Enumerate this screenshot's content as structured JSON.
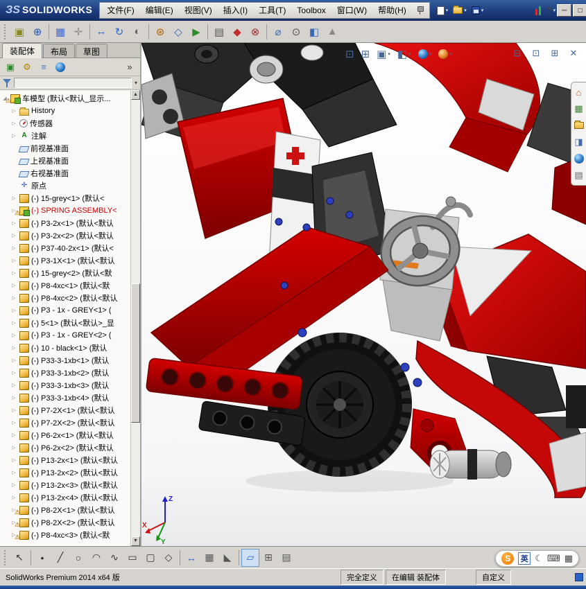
{
  "window": {
    "logo_mark": "ЗS",
    "logo_text": "SOLIDWORKS",
    "buttons": [
      {
        "name": "minimize-button",
        "glyph": "─"
      },
      {
        "name": "maximize-button",
        "glyph": "□"
      },
      {
        "name": "close-button",
        "glyph": "✕"
      }
    ]
  },
  "menubar": [
    "文件(F)",
    "编辑(E)",
    "视图(V)",
    "插入(I)",
    "工具(T)",
    "Toolbox",
    "窗口(W)",
    "帮助(H)"
  ],
  "quickbar": [
    {
      "name": "new-document-button",
      "type": "page",
      "caret": true
    },
    {
      "name": "open-button",
      "type": "folder",
      "caret": true
    },
    {
      "name": "save-button",
      "type": "floppy",
      "caret": true
    },
    {
      "gap": true
    },
    {
      "name": "rebuild-indicator-icon",
      "type": "bars"
    },
    {
      "name": "help-button",
      "type": "glyph",
      "glyph": "?",
      "caret": true
    }
  ],
  "toolbar": [
    {
      "name": "insert-component-icon",
      "glyph": "▣",
      "color": "#8a8a20"
    },
    {
      "name": "mate-icon",
      "glyph": "⊕",
      "color": "#2255bb"
    },
    {
      "sep": true
    },
    {
      "name": "linear-pattern-icon",
      "glyph": "▦",
      "color": "#4466cc"
    },
    {
      "name": "smart-fasteners-icon",
      "glyph": "✛",
      "color": "#888888"
    },
    {
      "sep": true
    },
    {
      "name": "move-component-icon",
      "glyph": "↔",
      "color": "#2a6ad0"
    },
    {
      "name": "rotate-component-icon",
      "glyph": "↻",
      "color": "#2a6ad0"
    },
    {
      "name": "show-hidden-components-icon",
      "glyph": "◐",
      "color": "#666666"
    },
    {
      "sep": true
    },
    {
      "name": "assembly-features-icon",
      "glyph": "⊛",
      "color": "#b06000"
    },
    {
      "name": "reference-geometry-icon",
      "glyph": "◇",
      "color": "#3a6ab5"
    },
    {
      "name": "motion-study-icon",
      "glyph": "▶",
      "color": "#2e8b2e"
    },
    {
      "sep": true
    },
    {
      "name": "bom-icon",
      "glyph": "▤",
      "color": "#555555"
    },
    {
      "name": "exploded-view-icon",
      "glyph": "◆",
      "color": "#c03030"
    },
    {
      "name": "interference-check-icon",
      "glyph": "⊗",
      "color": "#a03030"
    },
    {
      "sep": true
    },
    {
      "name": "measure-icon",
      "glyph": "⌀",
      "color": "#3a6ab5"
    },
    {
      "name": "mass-properties-icon",
      "glyph": "⊙",
      "color": "#555555"
    },
    {
      "name": "section-view-icon",
      "glyph": "◧",
      "color": "#3a6ab5"
    },
    {
      "name": "instant3d-icon",
      "glyph": "▲",
      "color": "#888888"
    }
  ],
  "tabs": [
    {
      "label": "装配体",
      "active": true
    },
    {
      "label": "布局",
      "active": false
    },
    {
      "label": "草图",
      "active": false
    }
  ],
  "panel_toolbar": [
    {
      "name": "featuremanager-tree-tab-icon",
      "glyph": "▣",
      "color": "#2e8b2e"
    },
    {
      "name": "propertymanager-tab-icon",
      "glyph": "⚙",
      "color": "#b8860b"
    },
    {
      "name": "configurationmanager-tab-icon",
      "glyph": "≡",
      "color": "#5577bb"
    },
    {
      "name": "displaymanager-tab-icon",
      "type": "ball1"
    },
    {
      "name": "panel-expand-chevron",
      "glyph": "»",
      "color": "#333333",
      "right": true
    }
  ],
  "tree": [
    {
      "label": "车模型 (默认<默认_显示...",
      "icon": "assembly",
      "expander": "collapse",
      "warn": true,
      "level": 0
    },
    {
      "label": "History",
      "icon": "folder",
      "expander": "expand",
      "level": 1
    },
    {
      "label": "传感器",
      "icon": "sensors",
      "expander": "expand",
      "level": 1
    },
    {
      "label": "注解",
      "icon": "annotations",
      "expander": "expand",
      "level": 1
    },
    {
      "label": "前视基准面",
      "icon": "plane",
      "level": 1
    },
    {
      "label": "上视基准面",
      "icon": "plane",
      "level": 1
    },
    {
      "label": "右视基准面",
      "icon": "plane",
      "level": 1
    },
    {
      "label": "原点",
      "icon": "origin",
      "level": 1
    },
    {
      "label": "(-) 15-grey<1> (默认<",
      "icon": "part",
      "expander": "expand",
      "level": 1
    },
    {
      "label": "(-) SPRING ASSEMBLY<",
      "icon": "assembly",
      "expander": "expand",
      "warn": true,
      "red": true,
      "level": 1
    },
    {
      "label": "(-) P3-2x<1> (默认<默认",
      "icon": "part",
      "expander": "expand",
      "level": 1
    },
    {
      "label": "(-) P3-2x<2> (默认<默认",
      "icon": "part",
      "expander": "expand",
      "level": 1
    },
    {
      "label": "(-) P37-40-2x<1> (默认<",
      "icon": "part",
      "expander": "expand",
      "level": 1
    },
    {
      "label": "(-) P3-1X<1> (默认<默认",
      "icon": "part",
      "expander": "expand",
      "level": 1
    },
    {
      "label": "(-) 15-grey<2> (默认<默",
      "icon": "part",
      "expander": "expand",
      "level": 1
    },
    {
      "label": "(-) P8-4xc<1> (默认<默",
      "icon": "part",
      "expander": "expand",
      "level": 1
    },
    {
      "label": "(-) P8-4xc<2> (默认<默认",
      "icon": "part",
      "expander": "expand",
      "level": 1
    },
    {
      "label": "(-) P3 - 1x - GREY<1> (",
      "icon": "part",
      "expander": "expand",
      "level": 1
    },
    {
      "label": "(-) 5<1> (默认<默认>_显",
      "icon": "part",
      "expander": "expand",
      "level": 1
    },
    {
      "label": "(-) P3 - 1x - GREY<2> (",
      "icon": "part",
      "expander": "expand",
      "level": 1
    },
    {
      "label": "(-) 10 - black<1> (默认",
      "icon": "part",
      "expander": "expand",
      "level": 1
    },
    {
      "label": "(-) P33-3-1xb<1> (默认",
      "icon": "part",
      "expander": "expand",
      "level": 1
    },
    {
      "label": "(-) P33-3-1xb<2> (默认",
      "icon": "part",
      "expander": "expand",
      "level": 1
    },
    {
      "label": "(-) P33-3-1xb<3> (默认",
      "icon": "part",
      "expander": "expand",
      "level": 1
    },
    {
      "label": "(-) P33-3-1xb<4> (默认",
      "icon": "part",
      "expander": "expand",
      "level": 1
    },
    {
      "label": "(-) P7-2X<1> (默认<默认",
      "icon": "part",
      "expander": "expand",
      "level": 1
    },
    {
      "label": "(-) P7-2X<2> (默认<默认",
      "icon": "part",
      "expander": "expand",
      "level": 1
    },
    {
      "label": "(-) P6-2x<1> (默认<默认",
      "icon": "part",
      "expander": "expand",
      "level": 1
    },
    {
      "label": "(-) P6-2x<2> (默认<默认",
      "icon": "part",
      "expander": "expand",
      "level": 1
    },
    {
      "label": "(-) P13-2x<1> (默认<默认",
      "icon": "part",
      "expander": "expand",
      "level": 1
    },
    {
      "label": "(-) P13-2x<2> (默认<默认",
      "icon": "part",
      "expander": "expand",
      "level": 1
    },
    {
      "label": "(-) P13-2x<3> (默认<默认",
      "icon": "part",
      "expander": "expand",
      "level": 1
    },
    {
      "label": "(-) P13-2x<4> (默认<默认",
      "icon": "part",
      "expander": "expand",
      "level": 1
    },
    {
      "label": "(-) P8-2X<1> (默认<默认",
      "icon": "part",
      "expander": "expand",
      "warn": true,
      "level": 1
    },
    {
      "label": "(-) P8-2X<2> (默认<默认",
      "icon": "part",
      "expander": "expand",
      "warn": true,
      "level": 1
    },
    {
      "label": "(-) P8-4xc<3> (默认<默",
      "icon": "part",
      "expander": "expand",
      "warn": true,
      "level": 1
    }
  ],
  "hud": [
    {
      "name": "zoom-fit-icon",
      "glyph": "⊡",
      "color": "#456a9a"
    },
    {
      "name": "zoom-area-icon",
      "glyph": "⊞",
      "color": "#456a9a"
    },
    {
      "name": "view-orientation-icon",
      "glyph": "▣",
      "color": "#456a9a",
      "caret": true
    },
    {
      "name": "display-style-icon",
      "glyph": "◧",
      "color": "#456a9a",
      "caret": true
    },
    {
      "name": "appearances-icon",
      "type": "ball1",
      "caret": true
    },
    {
      "name": "scene-icon",
      "type": "ball2",
      "caret": true
    }
  ],
  "doc_buttons": [
    {
      "name": "doc-minimize-button",
      "glyph": "⊟",
      "color": "#456a9a"
    },
    {
      "name": "doc-restore-button",
      "glyph": "⊡",
      "color": "#456a9a"
    },
    {
      "name": "doc-tile-button",
      "glyph": "⊞",
      "color": "#456a9a"
    },
    {
      "name": "doc-close-button",
      "glyph": "✕",
      "color": "#456a9a"
    }
  ],
  "taskpane": [
    {
      "name": "resources-home-icon",
      "glyph": "⌂",
      "color": "#c05a20"
    },
    {
      "name": "design-library-icon",
      "glyph": "▦",
      "color": "#2e8b2e"
    },
    {
      "name": "file-explorer-icon",
      "type": "folder"
    },
    {
      "name": "view-palette-icon",
      "glyph": "◨",
      "color": "#4466aa"
    },
    {
      "name": "appearances-scenes-icon",
      "type": "ball1"
    },
    {
      "name": "custom-properties-icon",
      "glyph": "▤",
      "color": "#666666"
    }
  ],
  "bottombar": [
    {
      "name": "select-icon",
      "glyph": "↖",
      "color": "#333333"
    },
    {
      "sep": true
    },
    {
      "name": "sketch-point-icon",
      "glyph": "•",
      "color": "#333333"
    },
    {
      "name": "sketch-line-icon",
      "glyph": "╱",
      "color": "#333333"
    },
    {
      "name": "sketch-circle-icon",
      "glyph": "○",
      "color": "#333333"
    },
    {
      "name": "sketch-arc-icon",
      "glyph": "◠",
      "color": "#333333"
    },
    {
      "name": "sketch-spline-icon",
      "glyph": "∿",
      "color": "#333333"
    },
    {
      "name": "sketch-rectangle-icon",
      "glyph": "▭",
      "color": "#333333"
    },
    {
      "name": "sketch-slot-icon",
      "glyph": "▢",
      "color": "#333333"
    },
    {
      "name": "sketch-polygon-icon",
      "glyph": "◇",
      "color": "#333333"
    },
    {
      "sep": true
    },
    {
      "name": "smart-dimension-icon",
      "glyph": "↔",
      "color": "#2a6ad0"
    },
    {
      "name": "grid-snap-icon",
      "glyph": "▦",
      "color": "#555555"
    },
    {
      "name": "chamfer-icon",
      "glyph": "◣",
      "color": "#555555"
    },
    {
      "sep": true
    },
    {
      "name": "normal-to-icon",
      "glyph": "▱",
      "color": "#2a6ad0",
      "pressed": true
    },
    {
      "name": "table-icon",
      "glyph": "⊞",
      "color": "#555555"
    },
    {
      "name": "bom-table-icon",
      "glyph": "▤",
      "color": "#555555"
    }
  ],
  "statusbar": {
    "app": "SolidWorks Premium 2014 x64 版",
    "fully_defined": "完全定义",
    "editing": "在编辑 装配体",
    "custom": "自定义"
  },
  "ime": {
    "logo": "S",
    "lang": "英",
    "icons": [
      {
        "name": "moon-icon",
        "glyph": "☾"
      },
      {
        "name": "keyboard-icon",
        "glyph": "⌨"
      },
      {
        "name": "ime-toolbox-icon",
        "glyph": "▦"
      }
    ]
  },
  "viewport": {
    "triad": {
      "x": "X",
      "y": "Y",
      "z": "Z"
    }
  }
}
